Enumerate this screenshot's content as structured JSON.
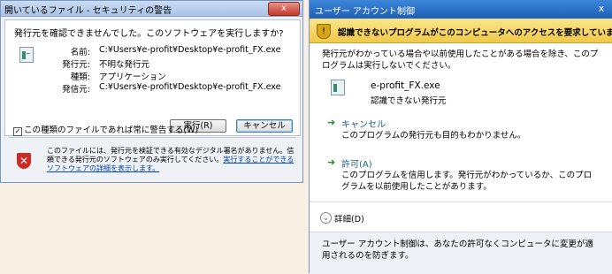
{
  "security_dialog": {
    "title": "開いているファイル - セキュリティの警告",
    "close_label": "x",
    "question": "発行元を確認できませんでした。このソフトウェアを実行しますか?",
    "fields": [
      {
        "label": "名前:",
        "value": "C:¥Users¥e-profit¥Desktop¥e-profit_FX.exe"
      },
      {
        "label": "発行元:",
        "value": "不明な発行元"
      },
      {
        "label": "種類:",
        "value": "アプリケーション"
      },
      {
        "label": "発信元:",
        "value": "C:¥Users¥e-profit¥Desktop¥e-profit_FX.exe"
      }
    ],
    "run_button": "実行(R)",
    "cancel_button": "キャンセル",
    "always_warn": "この種類のファイルであれば常に警告する(W)",
    "warning_text": "このファイルには、発行元を検証できる有効なデジタル署名がありません。信頼できる発行元のソフトウェアのみ実行してください。",
    "warning_link": "実行することができるソフトウェアの詳細を表示します。"
  },
  "uac_dialog": {
    "title": "ユーザー アカウント制御",
    "close_label": "x",
    "banner": "認識できないプログラムがこのコンピュータへのアクセスを要求しています",
    "description": "発行元がわかっている場合や以前使用したことがある場合を除き、このプログラムは実行しないでください。",
    "file_name": "e-profit_FX.exe",
    "file_publisher": "認識できない発行元",
    "options": [
      {
        "title": "キャンセル",
        "desc": "このプログラムの発行元も目的もわかりません。"
      },
      {
        "title": "許可(A)",
        "desc": "このプログラムを信用します。発行元がわかっているか、このプログラムを以前使用したことがあります。"
      }
    ],
    "details_label": "詳細(D)",
    "footer": "ユーザー アカウント制御は、あなたの許可なくコンピュータに変更が適用されるのを防ぎます。"
  }
}
